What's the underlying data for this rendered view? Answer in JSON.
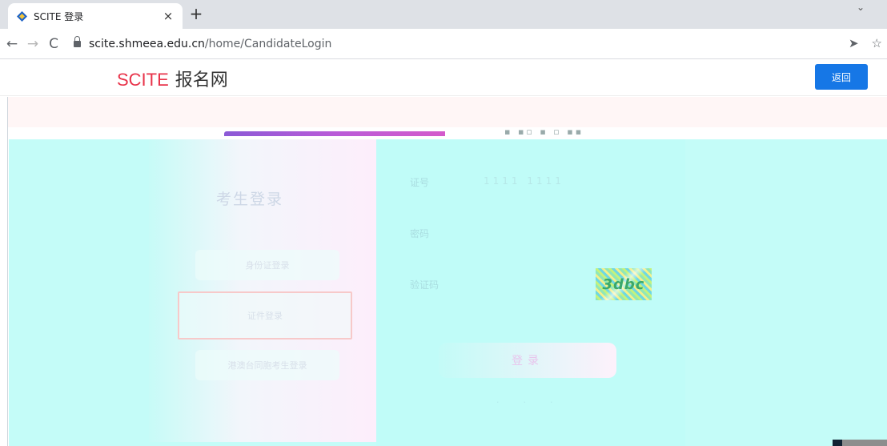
{
  "browser": {
    "tab_title": "SCITE 登录",
    "tab_close": "×",
    "new_tab": "+",
    "url_host": "scite.shmeea.edu.cn",
    "url_path": "/home/CandidateLogin",
    "icons": [
      "back-arrow-icon",
      "forward-arrow-icon",
      "reload-icon",
      "lock-icon",
      "share-icon",
      "star-icon"
    ]
  },
  "header": {
    "brand_latin": "SCITE",
    "brand_cn": "报名网",
    "back_button": "返回",
    "accent_color": "#1677e6",
    "brand_color": "#e8334a"
  },
  "login": {
    "title": "考生登录",
    "options": [
      "身份证登录",
      "证件登录",
      "港澳台同胞考生登录"
    ],
    "field_id_label": "证号",
    "field_id_value": "1111 1111",
    "field_password_label": "密码",
    "field_captcha_label": "验证码",
    "captcha_text": "3dbc",
    "submit_label": "登录"
  }
}
